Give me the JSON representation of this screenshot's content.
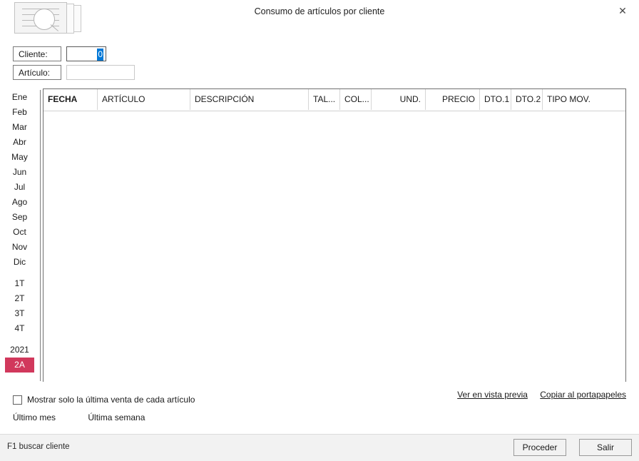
{
  "window": {
    "title": "Consumo de artículos por cliente",
    "close_label": "✕",
    "icon_name": "document-search-icon"
  },
  "filters": {
    "cliente": {
      "label": "Cliente:",
      "value": "0",
      "placeholder": ""
    },
    "articulo": {
      "label": "Artículo:",
      "value": "",
      "placeholder": ""
    }
  },
  "sidebar": {
    "months": [
      {
        "label": "Ene"
      },
      {
        "label": "Feb"
      },
      {
        "label": "Mar"
      },
      {
        "label": "Abr"
      },
      {
        "label": "May"
      },
      {
        "label": "Jun"
      },
      {
        "label": "Jul"
      },
      {
        "label": "Ago"
      },
      {
        "label": "Sep"
      },
      {
        "label": "Oct"
      },
      {
        "label": "Nov"
      },
      {
        "label": "Dic"
      }
    ],
    "quarters": [
      {
        "label": "1T"
      },
      {
        "label": "2T"
      },
      {
        "label": "3T"
      },
      {
        "label": "4T"
      }
    ],
    "years": [
      {
        "label": "2021",
        "selected": false
      },
      {
        "label": "2A",
        "selected": true
      }
    ],
    "selected_color": "#d1385c"
  },
  "grid": {
    "columns": [
      {
        "label": "FECHA",
        "bold": true,
        "align": "left"
      },
      {
        "label": "ARTÍCULO",
        "bold": false,
        "align": "left"
      },
      {
        "label": "DESCRIPCIÓN",
        "bold": false,
        "align": "left"
      },
      {
        "label": "TAL...",
        "bold": false,
        "align": "left"
      },
      {
        "label": "COL...",
        "bold": false,
        "align": "left"
      },
      {
        "label": "UND.",
        "bold": false,
        "align": "right"
      },
      {
        "label": "PRECIO",
        "bold": false,
        "align": "right"
      },
      {
        "label": "DTO.1",
        "bold": false,
        "align": "left"
      },
      {
        "label": "DTO.2",
        "bold": false,
        "align": "left"
      },
      {
        "label": "TIPO MOV.",
        "bold": false,
        "align": "left"
      }
    ],
    "rows": []
  },
  "actions": {
    "preview_link": "Ver en vista previa",
    "clipboard_link": "Copiar al portapapeles",
    "checkbox_label": "Mostrar solo la última venta de cada artículo",
    "checkbox_checked": false,
    "last_month_link": "Último mes",
    "last_week_link": "Última semana"
  },
  "statusbar": {
    "hint": "F1 buscar cliente",
    "proceed_button": "Proceder",
    "exit_button": "Salir"
  }
}
